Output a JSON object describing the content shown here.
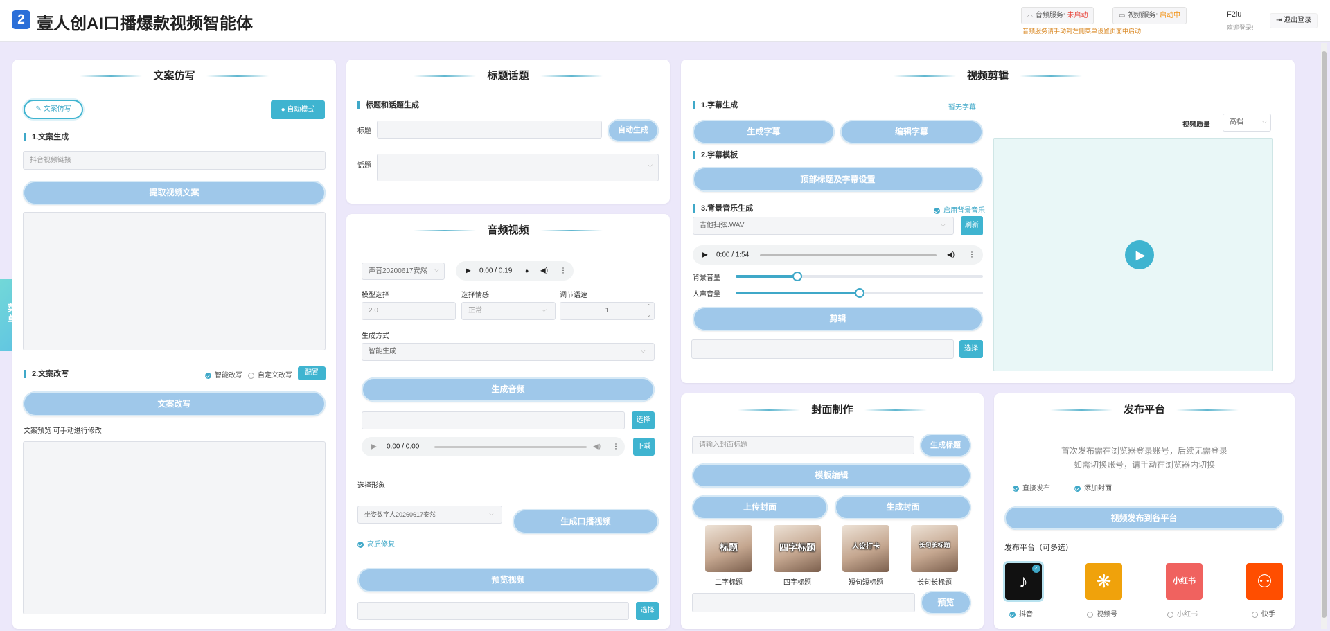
{
  "app": {
    "logo": "2",
    "title": "壹人创AI口播爆款视频智能体"
  },
  "services": {
    "audio_label": "音频服务:",
    "audio_status": "未启动",
    "video_label": "视频服务:",
    "video_status": "启动中",
    "note": "音频服务请手动到左侧菜单设置页面中启动"
  },
  "user": {
    "name": "F2iu",
    "welcome": "欢迎登录!",
    "logout": "退出登录"
  },
  "menu": {
    "label_top": "菜",
    "label_bottom": "单"
  },
  "copywriting": {
    "title": "文案仿写",
    "tab": "文案仿写",
    "auto_mode": "自动模式",
    "sec1": "1.文案生成",
    "link_placeholder": "抖音视频链接",
    "extract_btn": "提取视频文案",
    "sec2": "2.文案改写",
    "opt_smart": "智能改写",
    "opt_custom": "自定义改写",
    "config_btn": "配置",
    "rewrite_btn": "文案改写",
    "preview_label": "文案预览 可手动进行修改"
  },
  "title_topic": {
    "title": "标题话题",
    "sec": "标题和话题生成",
    "title_label": "标题",
    "auto_btn": "自动生成",
    "topic_label": "话题"
  },
  "audio_video": {
    "title": "音频视频",
    "voice": "声音20200617安然",
    "player1_time": "0:00 / 0:19",
    "model_label": "模型选择",
    "model_value": "2.0",
    "emotion_label": "选择情感",
    "emotion_value": "正常",
    "speed_label": "调节语速",
    "speed_value": "1",
    "mode_label": "生成方式",
    "mode_value": "智能生成",
    "gen_audio_btn": "生成音频",
    "select_btn": "选择",
    "player2_time": "0:00 / 0:00",
    "download_btn": "下载",
    "avatar_label": "选择形象",
    "avatar_value": "坐姿数字人20260617安然",
    "gen_video_btn": "生成口播视频",
    "opt_hd": "高质修复",
    "preview_btn": "预览视频",
    "select_btn2": "选择"
  },
  "video_edit": {
    "title": "视频剪辑",
    "sec1": "1.字幕生成",
    "no_subtitle": "暂无字幕",
    "gen_sub_btn": "生成字幕",
    "edit_sub_btn": "编辑字幕",
    "sec2": "2.字幕模板",
    "template_btn": "顶部标题及字幕设置",
    "sec3": "3.背景音乐生成",
    "bgm_toggle": "启用背景音乐",
    "bgm_file": "吉他扫弦.WAV",
    "refresh_btn": "刷新",
    "player_time": "0:00 / 1:54",
    "bg_volume_label": "背景音量",
    "bg_volume": 0.25,
    "voice_volume_label": "人声音量",
    "voice_volume": 0.5,
    "cut_btn": "剪辑",
    "select_btn": "选择",
    "quality_label": "视频质量",
    "quality_value": "高档"
  },
  "cover": {
    "title": "封面制作",
    "placeholder": "请输入封面标题",
    "gen_title_btn": "生成标题",
    "template_btn": "模板编辑",
    "upload_btn": "上传封面",
    "gen_cover_btn": "生成封面",
    "preview_btn": "预览",
    "items": [
      {
        "text": "标题",
        "caption": "二字标题"
      },
      {
        "text": "四字标题",
        "caption": "四字标题"
      },
      {
        "text": "人设打卡",
        "caption": "短句短标题"
      },
      {
        "text": "长句长标题",
        "caption": "长句长标题"
      }
    ]
  },
  "publish": {
    "title": "发布平台",
    "note1": "首次发布需在浏览器登录账号，后续无需登录",
    "note2": "如需切换账号，请手动在浏览器内切换",
    "opt_direct": "直接发布",
    "opt_cover": "添加封面",
    "publish_btn": "视频发布到各平台",
    "platforms_label": "发布平台（可多选）",
    "platforms": [
      {
        "name": "抖音",
        "icon": "♪",
        "color": "#111111",
        "checked": true
      },
      {
        "name": "视频号",
        "icon": "❋",
        "color": "#f0a20b",
        "checked": false
      },
      {
        "name": "小红书",
        "icon": "小红书",
        "color": "#f0625f",
        "checked": false
      },
      {
        "name": "快手",
        "icon": "⚇",
        "color": "#ff4e00",
        "checked": false
      }
    ]
  }
}
